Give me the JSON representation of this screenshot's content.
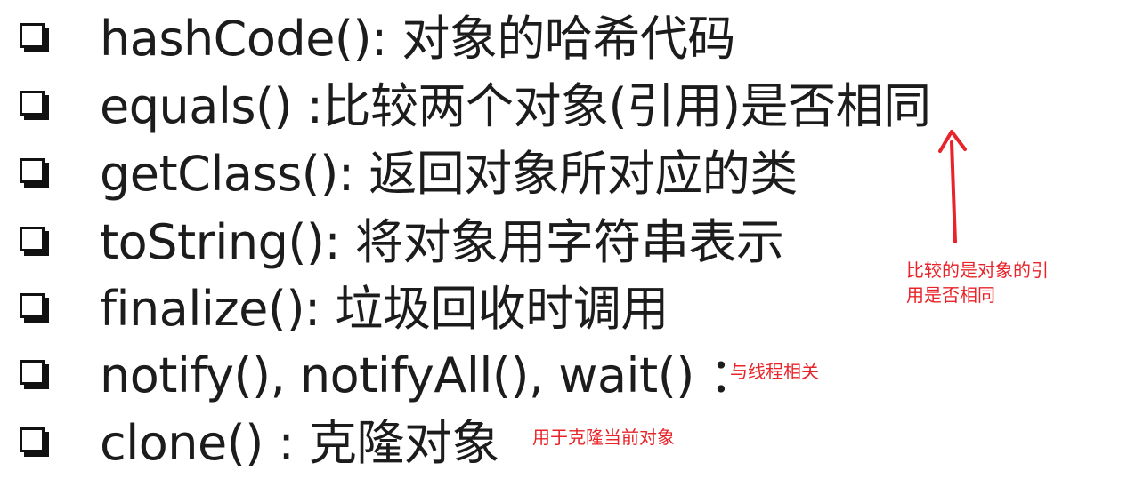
{
  "items": [
    {
      "text": "hashCode(): 对象的哈希代码"
    },
    {
      "text": "equals() :比较两个对象(引用)是否相同"
    },
    {
      "text": "getClass(): 返回对象所对应的类"
    },
    {
      "text": "toString(): 将对象用字符串表示"
    },
    {
      "text": "finalize(): 垃圾回收时调用"
    },
    {
      "text": "notify(), notifyAll(), wait() ："
    },
    {
      "text": "clone() : 克隆对象"
    }
  ],
  "annotations": {
    "equals_note": "比较的是对象的引用是否相同",
    "thread_note": "与线程相关",
    "clone_note": "用于克隆当前对象"
  },
  "colors": {
    "text": "#1c1c1c",
    "annotation": "#e8242a",
    "checkbox": "#111111"
  }
}
